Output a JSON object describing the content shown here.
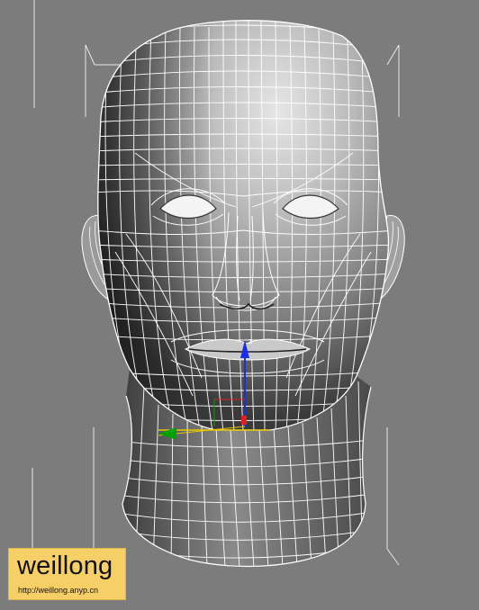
{
  "viewport": {
    "background_color": "#7c7c7c",
    "wireframe_color": "#ffffff",
    "object": "head-mesh"
  },
  "gizmo": {
    "axis_x_color": "#e8c800",
    "axis_y_color": "#00a000",
    "axis_z_color": "#1a2ee6"
  },
  "watermark": {
    "brand": "weillong",
    "url": "http://weillong.anyp.cn",
    "background_color": "#f7cf67"
  }
}
